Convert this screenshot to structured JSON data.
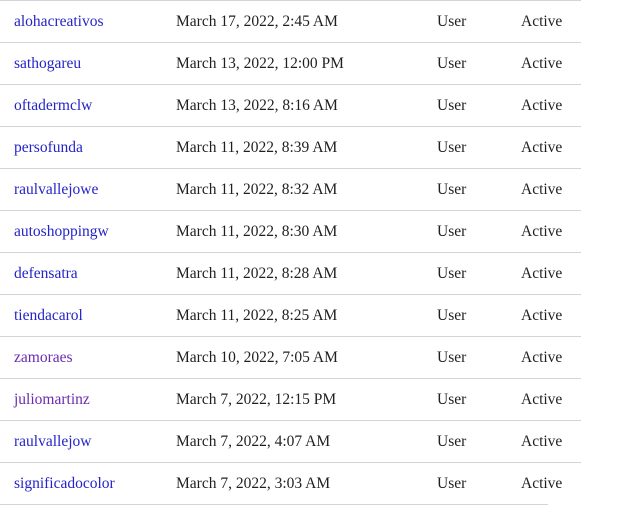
{
  "table": {
    "columns": [
      "username",
      "date",
      "role",
      "status"
    ],
    "rows": [
      {
        "username": "alohacreativos",
        "date": "March 17, 2022, 2:45 AM",
        "role": "User",
        "status": "Active",
        "visited": false
      },
      {
        "username": "sathogareu",
        "date": "March 13, 2022, 12:00 PM",
        "role": "User",
        "status": "Active",
        "visited": false
      },
      {
        "username": "oftadermclw",
        "date": "March 13, 2022, 8:16 AM",
        "role": "User",
        "status": "Active",
        "visited": false
      },
      {
        "username": "persofunda",
        "date": "March 11, 2022, 8:39 AM",
        "role": "User",
        "status": "Active",
        "visited": false
      },
      {
        "username": "raulvallejowe",
        "date": "March 11, 2022, 8:32 AM",
        "role": "User",
        "status": "Active",
        "visited": false
      },
      {
        "username": "autoshoppingw",
        "date": "March 11, 2022, 8:30 AM",
        "role": "User",
        "status": "Active",
        "visited": false
      },
      {
        "username": "defensatra",
        "date": "March 11, 2022, 8:28 AM",
        "role": "User",
        "status": "Active",
        "visited": false
      },
      {
        "username": "tiendacarol",
        "date": "March 11, 2022, 8:25 AM",
        "role": "User",
        "status": "Active",
        "visited": false
      },
      {
        "username": "zamoraes",
        "date": "March 10, 2022, 7:05 AM",
        "role": "User",
        "status": "Active",
        "visited": true
      },
      {
        "username": "juliomartinz",
        "date": "March 7, 2022, 12:15 PM",
        "role": "User",
        "status": "Active",
        "visited": true
      },
      {
        "username": "raulvallejow",
        "date": "March 7, 2022, 4:07 AM",
        "role": "User",
        "status": "Active",
        "visited": false
      },
      {
        "username": "significadocolor",
        "date": "March 7, 2022, 3:03 AM",
        "role": "User",
        "status": "Active",
        "visited": false
      }
    ]
  },
  "colors": {
    "link": "#2424c8",
    "link_visited": "#6b2bb0",
    "text": "#1f1f1f",
    "divider": "#d4d4d4",
    "background": "#ffffff"
  }
}
